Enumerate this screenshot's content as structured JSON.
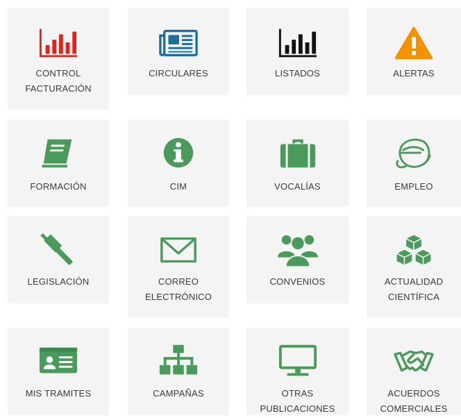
{
  "colors": {
    "tile_bg": "#f4f4f4",
    "green": "#4a9a5c",
    "red": "#e2231a",
    "blue": "#1e6e9e",
    "black": "#111111",
    "orange": "#f39200",
    "text": "#3a3a3a"
  },
  "tiles": [
    {
      "label": "CONTROL\nFACTURACIÓN",
      "icon": "bar-chart-icon",
      "color": "#e2231a"
    },
    {
      "label": "CIRCULARES",
      "icon": "newspaper-icon",
      "color": "#1e6e9e"
    },
    {
      "label": "LISTADOS",
      "icon": "bar-chart-icon",
      "color": "#111111"
    },
    {
      "label": "ALERTAS",
      "icon": "warning-icon",
      "color": "#f39200"
    },
    {
      "label": "FORMACIÓN",
      "icon": "book-icon",
      "color": "#4a9a5c"
    },
    {
      "label": "CIM",
      "icon": "info-icon",
      "color": "#4a9a5c"
    },
    {
      "label": "VOCALÍAS",
      "icon": "briefcase-icon",
      "color": "#4a9a5c"
    },
    {
      "label": "EMPLEO",
      "icon": "swirl-e-icon",
      "color": "#4a9a5c"
    },
    {
      "label": "LEGISLACIÓN",
      "icon": "gavel-icon",
      "color": "#4a9a5c"
    },
    {
      "label": "CORREO\nELECTRÓNICO",
      "icon": "envelope-icon",
      "color": "#4a9a5c"
    },
    {
      "label": "CONVENIOS",
      "icon": "group-icon",
      "color": "#4a9a5c"
    },
    {
      "label": "ACTUALIDAD\nCIENTÍFICA",
      "icon": "cubes-icon",
      "color": "#4a9a5c"
    },
    {
      "label": "MIS TRAMITES",
      "icon": "id-card-icon",
      "color": "#4a9a5c"
    },
    {
      "label": "CAMPAÑAS",
      "icon": "sitemap-icon",
      "color": "#4a9a5c"
    },
    {
      "label": "OTRAS\nPUBLICACIONES",
      "icon": "monitor-icon",
      "color": "#4a9a5c"
    },
    {
      "label": "ACUERDOS\nCOMERCIALES",
      "icon": "handshake-icon",
      "color": "#4a9a5c"
    }
  ]
}
